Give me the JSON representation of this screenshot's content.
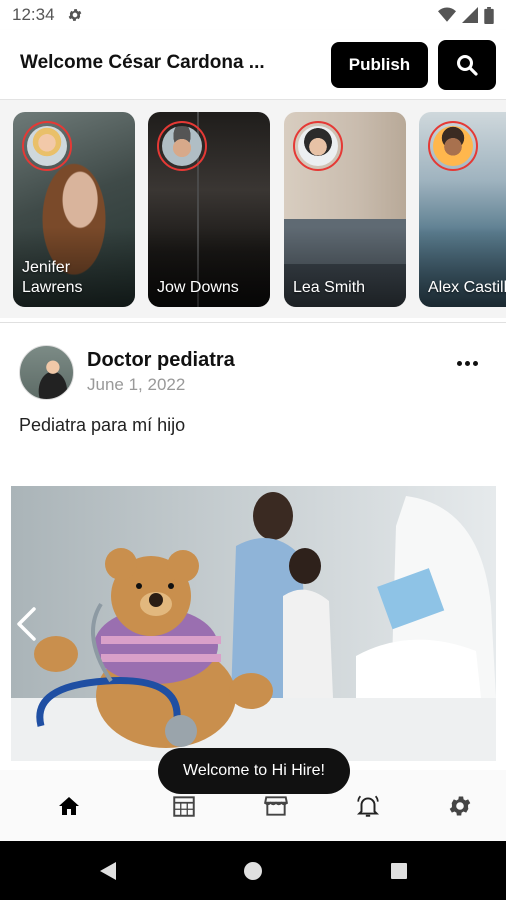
{
  "status_bar": {
    "time": "12:34"
  },
  "header": {
    "welcome": "Welcome César Cardona ...",
    "publish_label": "Publish"
  },
  "stories": [
    {
      "name": "Jenifer Lawrens"
    },
    {
      "name": "Jow Downs"
    },
    {
      "name": "Lea Smith"
    },
    {
      "name": "Alex Castillo"
    }
  ],
  "post": {
    "author": "Doctor pediatra",
    "date": "June 1, 2022",
    "text": "Pediatra para mí hijo"
  },
  "toast": "Welcome to Hi Hire!",
  "colors": {
    "accent": "#000000",
    "story_ring": "#e53935"
  },
  "bottom_nav": [
    "home-icon",
    "calendar-icon",
    "store-icon",
    "bell-icon",
    "gear-icon"
  ]
}
